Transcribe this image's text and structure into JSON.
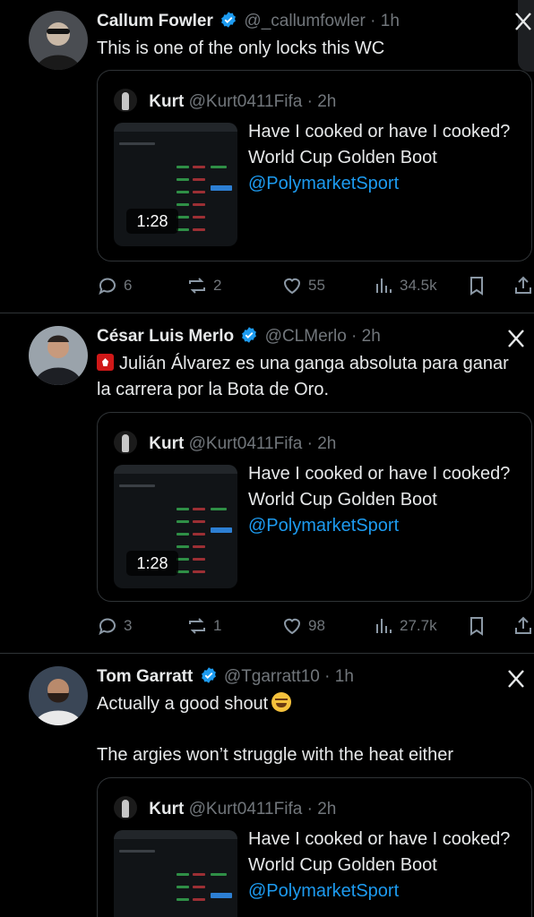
{
  "tweets": [
    {
      "name": "Callum Fowler",
      "handle": "@_callumfowler",
      "dot": "·",
      "time": "1h",
      "text": "This is one of the only locks this WC",
      "quote": {
        "name": "Kurt",
        "handle": "@Kurt0411Fifa",
        "dot": "·",
        "time": "2h",
        "video_duration": "1:28",
        "text": "Have I cooked or have I cooked? World Cup Golden Boot ",
        "mention": "@PolymarketSport"
      },
      "actions": {
        "replies": "6",
        "reposts": "2",
        "likes": "55",
        "views": "34.5k"
      }
    },
    {
      "name": "César Luis Merlo",
      "handle": "@CLMerlo",
      "dot": "·",
      "time": "2h",
      "text": "Julián Álvarez es una ganga absoluta para ganar la carrera por la Bota de Oro.",
      "quote": {
        "name": "Kurt",
        "handle": "@Kurt0411Fifa",
        "dot": "·",
        "time": "2h",
        "video_duration": "1:28",
        "text": "Have I cooked or have I cooked? World Cup Golden Boot ",
        "mention": "@PolymarketSport"
      },
      "actions": {
        "replies": "3",
        "reposts": "1",
        "likes": "98",
        "views": "27.7k"
      }
    },
    {
      "name": "Tom Garratt",
      "handle": "@Tgarratt10",
      "dot": "·",
      "time": "1h",
      "text_line1": "Actually a good shout",
      "text_line2": "The argies won’t struggle with the heat either",
      "quote": {
        "name": "Kurt",
        "handle": "@Kurt0411Fifa",
        "dot": "·",
        "time": "2h",
        "text": "Have I cooked or have I cooked? World Cup Golden Boot ",
        "mention": "@PolymarketSport"
      }
    }
  ],
  "colors": {
    "accent": "#1d9bf0",
    "muted": "#71767b",
    "text": "#e7e9ea",
    "verified": "#1d9bf0",
    "background": "#000000",
    "border": "#2f3336"
  },
  "icons": {
    "verified": "verified-badge-icon",
    "x": "x-logo-icon",
    "reply": "reply-icon",
    "repost": "repost-icon",
    "like": "like-icon",
    "views": "views-icon",
    "bookmark": "bookmark-icon",
    "share": "share-icon"
  }
}
